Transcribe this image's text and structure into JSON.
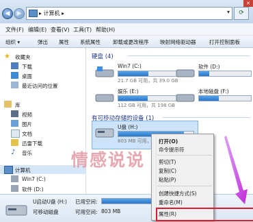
{
  "address": {
    "breadcrumb": "▸ 计算机 ▸",
    "refresh_icon": "refresh-icon"
  },
  "menu": [
    "文件(F)",
    "编辑(E)",
    "查看(V)",
    "工具(T)",
    "帮助(H)"
  ],
  "toolbar": [
    "组织 ▾",
    "弹出",
    "属性",
    "系统属性",
    "卸载或更改程序",
    "映射网络驱动器",
    "打开控制面板"
  ],
  "nav": {
    "favorites": "收藏夹",
    "downloads": "下载",
    "desktop": "桌面",
    "recent": "最近访问的位置",
    "libraries": "库",
    "videos": "视频",
    "pictures": "图片",
    "documents": "文档",
    "thunder": "迅雷下载",
    "music": "音乐",
    "computer": "计算机",
    "win7": "Win7 (C:)",
    "soft": "软件 (D:)"
  },
  "sections": {
    "hdd": "硬盘 (4)",
    "removable": "有可移动存储的设备 (1)"
  },
  "drives": [
    {
      "name": "Win7 (C:)",
      "free": "21.7 GB 可用，共 39.0 GB",
      "used": 0.44
    },
    {
      "name": "软件 (D:)",
      "free": "",
      "used": 0.2
    },
    {
      "name": "娱乐 (E:)",
      "free": "112 GB 可用，共 198 GB",
      "used": 0.43
    },
    {
      "name": "本地磁盘 (F:)",
      "free": "",
      "used": 0.38
    }
  ],
  "usb": {
    "name": "U盘 (H:)",
    "free": "803 MB 可用，共 6",
    "used": 0.87
  },
  "context_menu": {
    "open": "打开(O)",
    "cmd": "命令提示符",
    "cut": "剪切(T)",
    "copy": "复制(C)",
    "paste": "粘贴(P)",
    "shortcut": "创建快捷方式(S)",
    "rename": "重命名(M)",
    "properties": "属性(R)"
  },
  "details": {
    "name": "U启动U盘 (H:)",
    "type": "可移动磁盘",
    "used_label": "已用空间:",
    "free_label": "可用空间:",
    "free": "803 MB"
  },
  "watermark": "情感说说"
}
